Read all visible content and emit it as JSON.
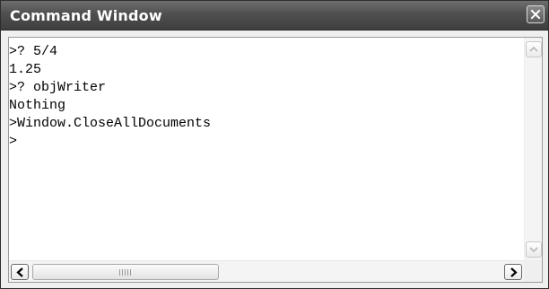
{
  "window": {
    "title": "Command Window",
    "close_icon": "close-icon"
  },
  "console": {
    "lines": [
      ">? 5/4",
      "1.25",
      ">? objWriter",
      "Nothing",
      ">Window.CloseAllDocuments",
      ">"
    ]
  },
  "scrollbars": {
    "icons": [
      "scroll-up-arrow-icon",
      "scroll-down-arrow-icon",
      "scroll-left-arrow-icon",
      "scroll-right-arrow-icon",
      "thumb-grip-icon"
    ]
  },
  "colors": {
    "titlebar": "#4f4f4f",
    "title_text": "#ffffff",
    "console_bg": "#ffffff",
    "console_text": "#000000"
  }
}
